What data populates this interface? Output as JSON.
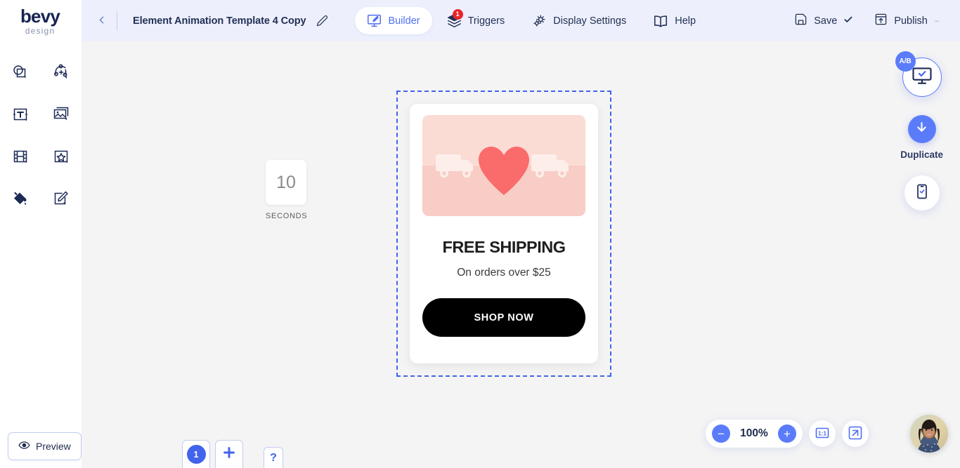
{
  "brand": {
    "name": "bevy",
    "tagline": "design"
  },
  "header": {
    "back_icon": "chevron-left-icon",
    "document_title": "Element Animation Template 4 Copy",
    "edit_icon": "pencil-icon",
    "tabs": [
      {
        "label": "Builder",
        "icon": "monitor-pencil-icon",
        "active": true,
        "badge": ""
      },
      {
        "label": "Triggers",
        "icon": "layers-icon",
        "active": false,
        "badge": "1"
      },
      {
        "label": "Display Settings",
        "icon": "gears-icon",
        "active": false,
        "badge": ""
      },
      {
        "label": "Help",
        "icon": "book-icon",
        "active": false,
        "badge": ""
      }
    ],
    "actions": [
      {
        "label": "Save",
        "icon": "floppy-disk-icon",
        "suffix": "check-icon"
      },
      {
        "label": "Publish",
        "icon": "publish-up-icon",
        "suffix": "dash-icon"
      }
    ]
  },
  "toolbar": {
    "tools": [
      {
        "name": "shapes-icon"
      },
      {
        "name": "add-node-icon"
      },
      {
        "name": "text-icon"
      },
      {
        "name": "image-icon"
      },
      {
        "name": "video-icon"
      },
      {
        "name": "star-icon"
      },
      {
        "name": "paint-bucket-icon"
      },
      {
        "name": "draw-edit-icon"
      }
    ],
    "preview_label": "Preview",
    "preview_icon": "eye-icon"
  },
  "canvas": {
    "timer": {
      "value": "10",
      "unit": "SECONDS"
    },
    "promo": {
      "image_alt": "heart-and-trucks-graphic",
      "title": "FREE SHIPPING",
      "subtitle": "On orders over $25",
      "cta_label": "SHOP NOW"
    },
    "selection_color": "#4263eb"
  },
  "device_rail": {
    "ab_badge": "A/B",
    "desktop_icon": "monitor-check-icon",
    "duplicate_icon": "arrow-down-circle-icon",
    "duplicate_label": "Duplicate",
    "mobile_icon": "mobile-check-icon"
  },
  "zoom": {
    "zoom_out_label": "−",
    "value": "100%",
    "zoom_in_label": "+",
    "actual_size_label": "1:1",
    "fit_icon": "expand-arrow-icon"
  },
  "pages": {
    "items": [
      {
        "number": "1"
      }
    ],
    "add_label": "+",
    "help_label": "?"
  },
  "colors": {
    "accent": "#4263eb",
    "accent_soft": "#5b7cfa",
    "topbar_bg": "#edf0fc",
    "canvas_bg": "#f4f4f5",
    "navy": "#1d2a4d",
    "badge_red": "#e8252a",
    "heart": "#fa6b6b",
    "promo_bg_top": "#fadcd5",
    "promo_bg_bottom": "#f7cdc5"
  }
}
